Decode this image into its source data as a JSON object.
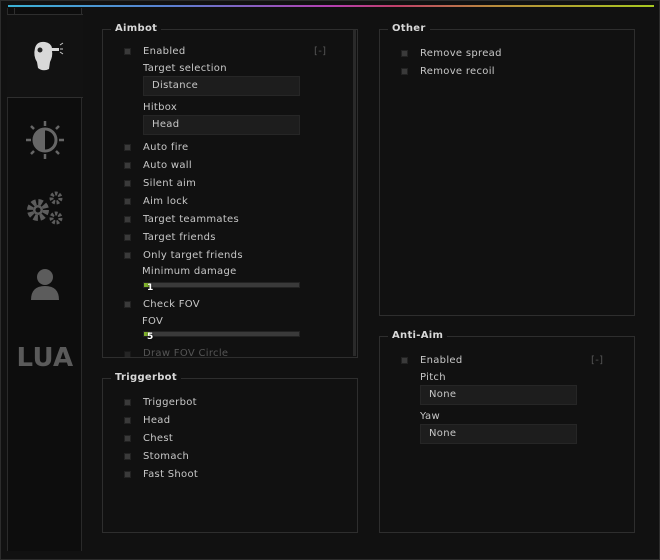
{
  "sidebar": {
    "tabs": [
      {
        "icon": "aimbot-head-icon",
        "active": true
      },
      {
        "icon": "visuals-contrast-icon"
      },
      {
        "icon": "misc-gears-icon"
      },
      {
        "icon": "user-icon"
      },
      {
        "label": "LUA"
      }
    ]
  },
  "aimbot": {
    "title": "Aimbot",
    "enabled": "Enabled",
    "collapse": "[-]",
    "target_selection_label": "Target selection",
    "target_selection": "Distance",
    "hitbox_label": "Hitbox",
    "hitbox": "Head",
    "options": [
      "Auto fire",
      "Auto wall",
      "Silent aim",
      "Aim lock",
      "Target teammates",
      "Target friends",
      "Only target friends"
    ],
    "min_damage_label": "Minimum damage",
    "min_damage": "1",
    "min_damage_fill_percent": 4,
    "check_fov": "Check FOV",
    "fov_label": "FOV",
    "fov": "5",
    "fov_fill_percent": 4,
    "draw_fov": "Draw FOV Circle"
  },
  "other": {
    "title": "Other",
    "options": [
      "Remove spread",
      "Remove recoil"
    ]
  },
  "triggerbot": {
    "title": "Triggerbot",
    "options": [
      "Triggerbot",
      "Head",
      "Chest",
      "Stomach",
      "Fast Shoot"
    ]
  },
  "antiaim": {
    "title": "Anti-Aim",
    "enabled": "Enabled",
    "collapse": "[-]",
    "pitch_label": "Pitch",
    "pitch": "None",
    "yaw_label": "Yaw",
    "yaw": "None"
  },
  "colors": {
    "accent": "#7fb02b",
    "background": "#111111"
  }
}
